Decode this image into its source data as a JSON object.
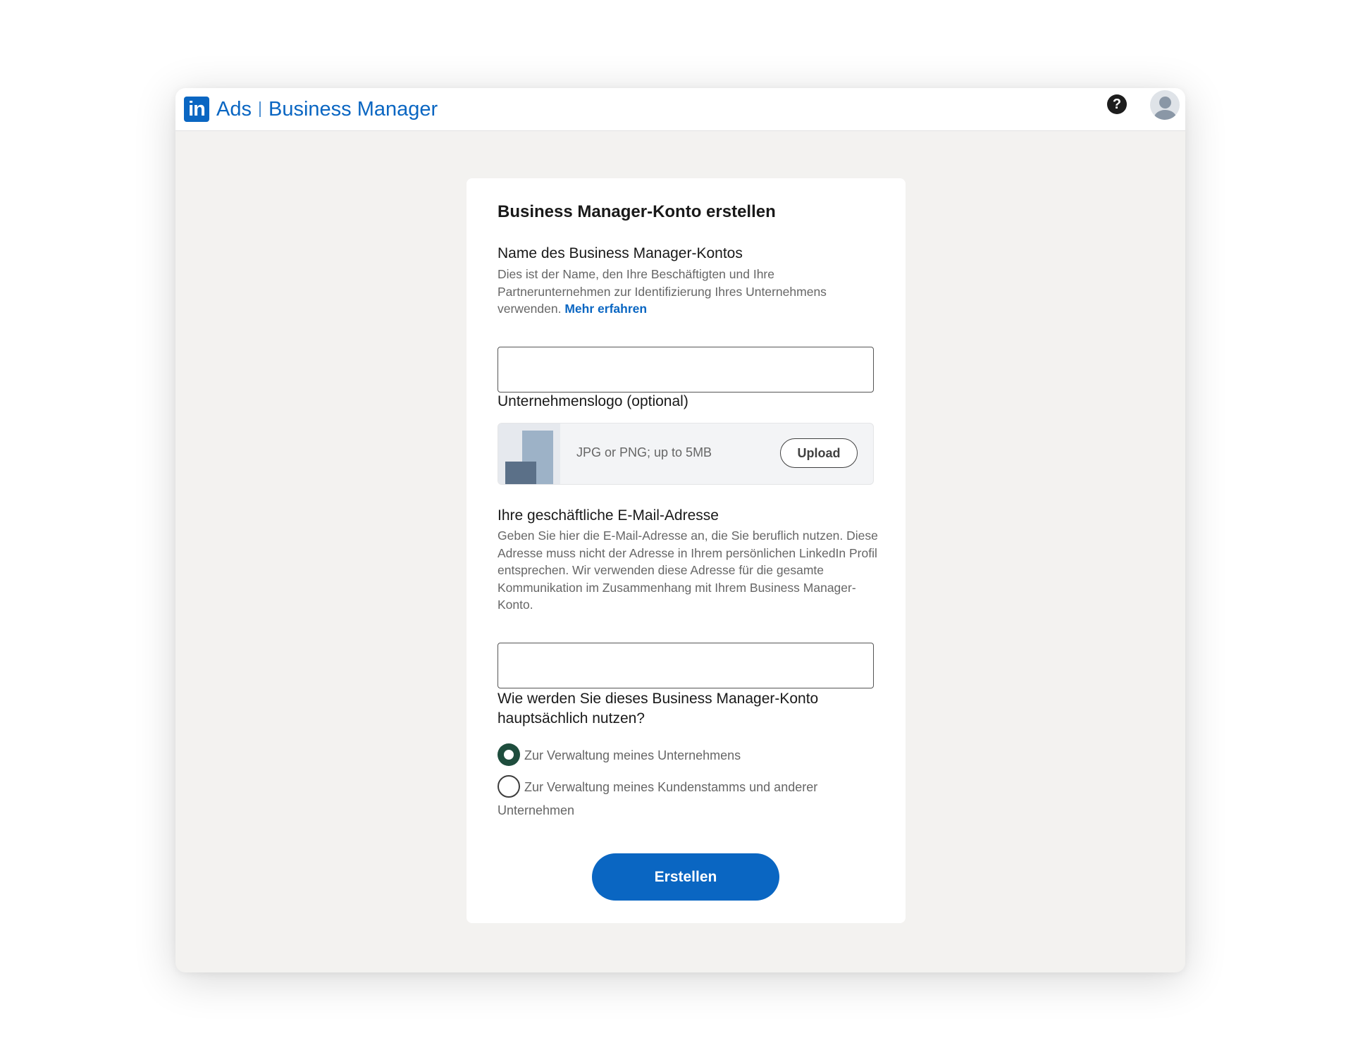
{
  "header": {
    "logo_text": "in",
    "product": "Ads",
    "title": "Business Manager",
    "help_symbol": "?",
    "icons": [
      "linkedin-logo",
      "help-icon",
      "avatar"
    ]
  },
  "form": {
    "title": "Business Manager-Konto erstellen",
    "account_name": {
      "label": "Name des Business Manager-Kontos",
      "description": "Dies ist der Name, den Ihre Beschäftigten und Ihre Partnerunternehmen zur Identifizierung Ihres Unternehmens verwenden.",
      "link": "Mehr erfahren",
      "value": ""
    },
    "logo": {
      "label": "Unternehmenslogo (optional)",
      "hint": "JPG or PNG; up to 5MB",
      "upload_label": "Upload"
    },
    "email": {
      "label": "Ihre geschäftliche E-Mail-Adresse",
      "description": "Geben Sie hier die E-Mail-Adresse an, die Sie beruflich nutzen. Diese Adresse muss nicht der Adresse in Ihrem persönlichen LinkedIn Profil entsprechen. Wir verwenden diese Adresse für die gesamte Kommunikation im Zusammenhang mit Ihrem Business Manager-Konto.",
      "value": ""
    },
    "usage": {
      "question": "Wie werden Sie dieses Business Manager-Konto hauptsächlich nutzen?",
      "options": [
        {
          "label": "Zur Verwaltung meines Unternehmens",
          "selected": true
        },
        {
          "label": "Zur Verwaltung meines Kundenstamms und anderer Unternehmen",
          "selected": false
        }
      ]
    },
    "submit_label": "Erstellen"
  },
  "colors": {
    "brand": "#0a66c2",
    "page_background": "#f3f2f0",
    "radio_selected": "#1e4d3d"
  }
}
